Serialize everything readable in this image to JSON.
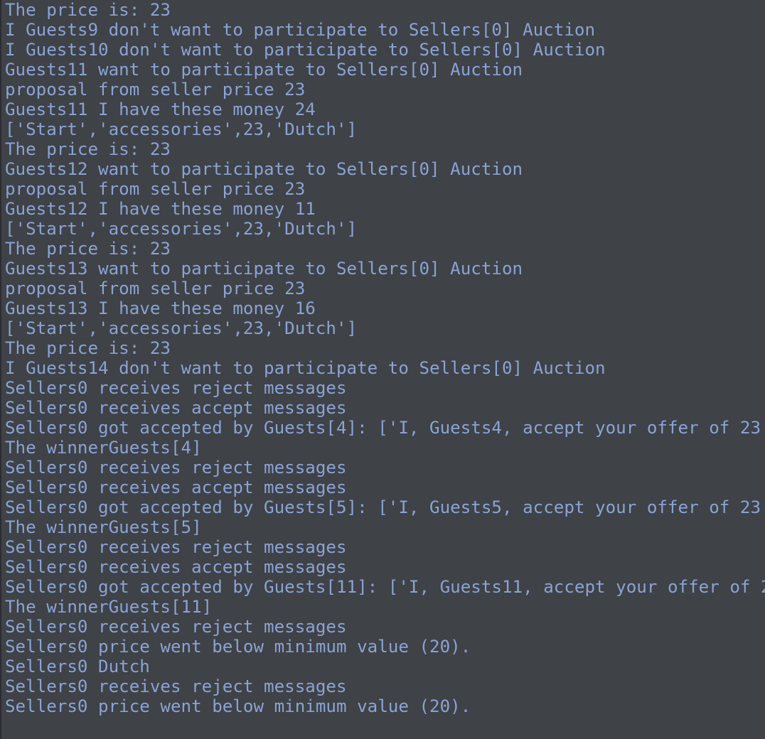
{
  "console": {
    "lines": [
      "The price is: 23",
      "I Guests9 don't want to participate to Sellers[0] Auction",
      "I Guests10 don't want to participate to Sellers[0] Auction",
      "Guests11 want to participate to Sellers[0] Auction",
      "proposal from seller price 23",
      "Guests11 I have these money 24",
      "['Start','accessories',23,'Dutch']",
      "The price is: 23",
      "Guests12 want to participate to Sellers[0] Auction",
      "proposal from seller price 23",
      "Guests12 I have these money 11",
      "['Start','accessories',23,'Dutch']",
      "The price is: 23",
      "Guests13 want to participate to Sellers[0] Auction",
      "proposal from seller price 23",
      "Guests13 I have these money 16",
      "['Start','accessories',23,'Dutch']",
      "The price is: 23",
      "I Guests14 don't want to participate to Sellers[0] Auction",
      "Sellers0 receives reject messages",
      "Sellers0 receives accept messages",
      "Sellers0 got accepted by Guests[4]: ['I, Guests4, accept your offer of 23'",
      "The winnerGuests[4]",
      "Sellers0 receives reject messages",
      "Sellers0 receives accept messages",
      "Sellers0 got accepted by Guests[5]: ['I, Guests5, accept your offer of 23'",
      "The winnerGuests[5]",
      "Sellers0 receives reject messages",
      "Sellers0 receives accept messages",
      "Sellers0 got accepted by Guests[11]: ['I, Guests11, accept your offer of 2",
      "The winnerGuests[11]",
      "Sellers0 receives reject messages",
      "Sellers0 price went below minimum value (20).",
      "Sellers0 Dutch",
      "Sellers0 receives reject messages",
      "Sellers0 price went below minimum value (20)."
    ]
  }
}
